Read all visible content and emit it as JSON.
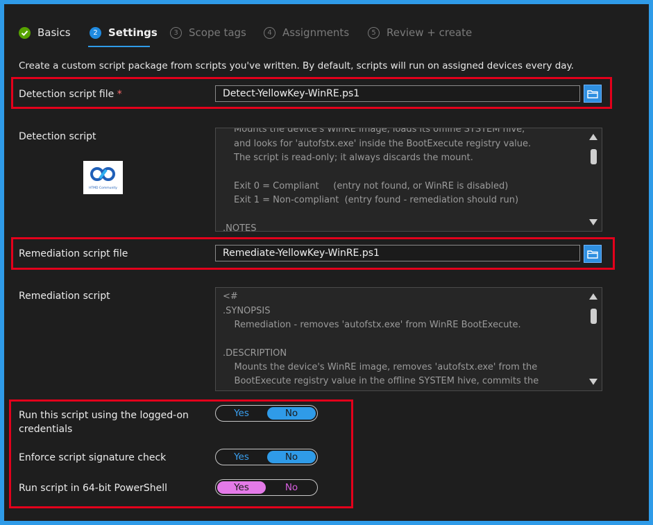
{
  "tabs": [
    {
      "label": "Basics",
      "state": "done",
      "num": ""
    },
    {
      "label": "Settings",
      "state": "current",
      "num": "2"
    },
    {
      "label": "Scope tags",
      "state": "future",
      "num": "3"
    },
    {
      "label": "Assignments",
      "state": "future",
      "num": "4"
    },
    {
      "label": "Review + create",
      "state": "future",
      "num": "5"
    }
  ],
  "description": "Create a custom script package from scripts you've written. By default, scripts will run on assigned devices every day.",
  "detection_file": {
    "label": "Detection script file",
    "required": "*",
    "value": "Detect-YellowKey-WinRE.ps1"
  },
  "detection_script": {
    "label": "Detection script",
    "lines": [
      "Mounts the device's WinRE image, loads its offline SYSTEM hive,",
      "and looks for 'autofstx.exe' inside the BootExecute registry value.",
      "The script is read-only; it always discards the mount.",
      "",
      "Exit 0 = Compliant     (entry not found, or WinRE is disabled)",
      "Exit 1 = Non-compliant  (entry found - remediation should run)",
      "",
      ".NOTES"
    ]
  },
  "logo": {
    "text": "HTMD Community"
  },
  "remediation_file": {
    "label": "Remediation script file",
    "value": "Remediate-YellowKey-WinRE.ps1"
  },
  "remediation_script": {
    "label": "Remediation script",
    "lines": [
      "<#",
      ".SYNOPSIS",
      "    Remediation - removes 'autofstx.exe' from WinRE BootExecute.",
      "",
      ".DESCRIPTION",
      "    Mounts the device's WinRE image, removes 'autofstx.exe' from the",
      "    BootExecute registry value in the offline SYSTEM hive, commits the"
    ]
  },
  "options": [
    {
      "label": "Run this script using the logged-on credentials",
      "yes": "Yes",
      "no": "No",
      "selected": "No"
    },
    {
      "label": "Enforce script signature check",
      "yes": "Yes",
      "no": "No",
      "selected": "No"
    },
    {
      "label": "Run script in 64-bit PowerShell",
      "yes": "Yes",
      "no": "No",
      "selected": "Yes"
    }
  ],
  "colors": {
    "accent": "#2f9be8",
    "highlight": "#e3001b",
    "success": "#57a300",
    "pink": "#e47ae8"
  }
}
